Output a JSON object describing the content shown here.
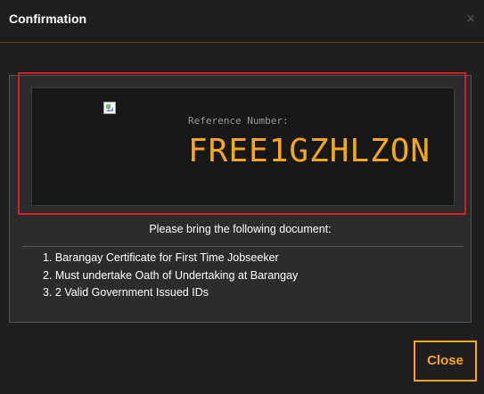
{
  "dialog": {
    "title": "Confirmation",
    "close_icon": "×"
  },
  "reference": {
    "image_icon": "broken-image-icon",
    "label": "Reference Number:",
    "number": "FREE1GZHLZON"
  },
  "documents": {
    "heading": "Please bring the following document:",
    "items": [
      "1. Barangay Certificate for First Time Jobseeker",
      "2. Must undertake Oath of Undertaking at Barangay",
      "3. 2 Valid Government Issued IDs"
    ]
  },
  "footer": {
    "close_label": "Close"
  },
  "colors": {
    "accent": "#f5a623",
    "highlight": "#dd1e1e",
    "background": "#1f1f1f"
  }
}
